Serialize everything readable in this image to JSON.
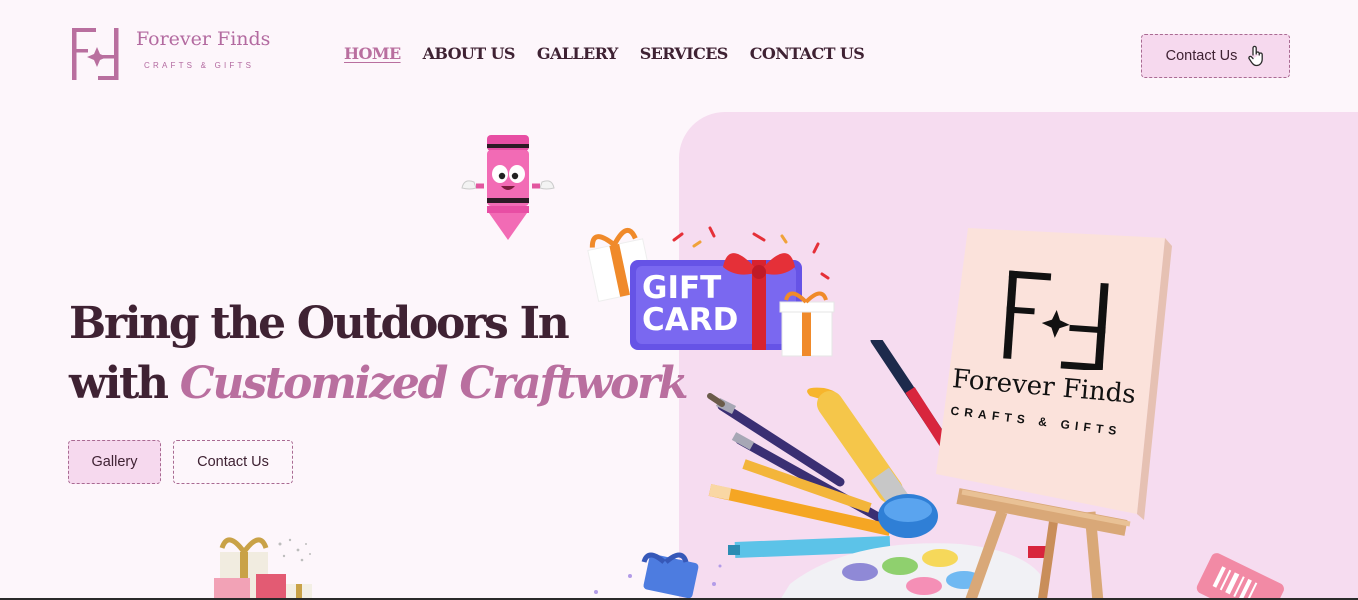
{
  "brand": {
    "name": "Forever Finds",
    "tagline": "CRAFTS & GIFTS",
    "accent_color": "#b96f9f",
    "dark_color": "#3f2233",
    "panel_color": "#f6dcf0"
  },
  "nav": {
    "items": [
      {
        "label": "HOME",
        "active": true
      },
      {
        "label": "ABOUT US",
        "active": false
      },
      {
        "label": "GALLERY",
        "active": false
      },
      {
        "label": "SERVICES",
        "active": false
      },
      {
        "label": "CONTACT US",
        "active": false
      }
    ]
  },
  "header": {
    "contact_label": "Contact Us",
    "contact_icon": "pointer-hand-icon"
  },
  "hero": {
    "line1": "Bring the Outdoors In",
    "line2_prefix": "with ",
    "line2_accent": "Customized Craftwork",
    "buttons": {
      "gallery": "Gallery",
      "contact": "Contact Us"
    }
  },
  "illustrations": {
    "gift_card_line1": "GIFT",
    "gift_card_line2": "CARD",
    "canvas_name": "Forever Finds",
    "canvas_tagline": "CRAFTS & GIFTS"
  }
}
